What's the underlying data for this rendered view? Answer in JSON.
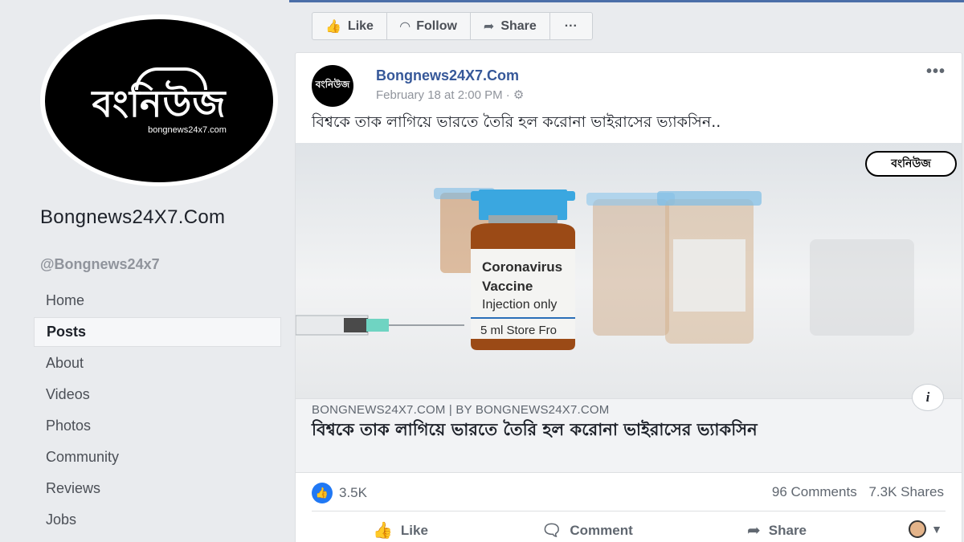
{
  "page": {
    "logo_main": "বংনিউজ",
    "logo_sub": "bongnews24x7.com",
    "name": "Bongnews24X7.Com",
    "handle": "@Bongnews24x7"
  },
  "nav": [
    {
      "label": "Home",
      "active": false
    },
    {
      "label": "Posts",
      "active": true
    },
    {
      "label": "About",
      "active": false
    },
    {
      "label": "Videos",
      "active": false
    },
    {
      "label": "Photos",
      "active": false
    },
    {
      "label": "Community",
      "active": false
    },
    {
      "label": "Reviews",
      "active": false
    },
    {
      "label": "Jobs",
      "active": false
    }
  ],
  "actionbar": {
    "like": "Like",
    "follow": "Follow",
    "share": "Share",
    "more": "···"
  },
  "post": {
    "avatar_text": "বংনিউজ",
    "author": "Bongnews24X7.Com",
    "time": "February 18 at 2:00 PM · ⚙",
    "more": "•••",
    "text": "বিশ্বকে তাক লাগিয়ে ভারতে তৈরি হল করোনা ভাইরাসের ভ্যাকসিন..",
    "image": {
      "watermark": "বংনিউজ",
      "vial_label": [
        "Coronavirus",
        "Vaccine",
        "Injection only",
        "5 ml  Store Fro"
      ]
    },
    "link_meta": "BONGNEWS24X7.COM | BY BONGNEWS24X7.COM",
    "link_title": "বিশ্বকে তাক লাগিয়ে ভারতে তৈরি হল করোনা ভাইরাসের ভ্যাকসিন",
    "info": "i",
    "likes": "3.5K",
    "comments": "96 Comments",
    "shares": "7.3K Shares",
    "actions": {
      "like": "Like",
      "comment": "Comment",
      "share": "Share"
    }
  },
  "colors": {
    "link_blue": "#365899",
    "like_blue": "#2078f4",
    "vial_cap": "#3aa7e0"
  }
}
